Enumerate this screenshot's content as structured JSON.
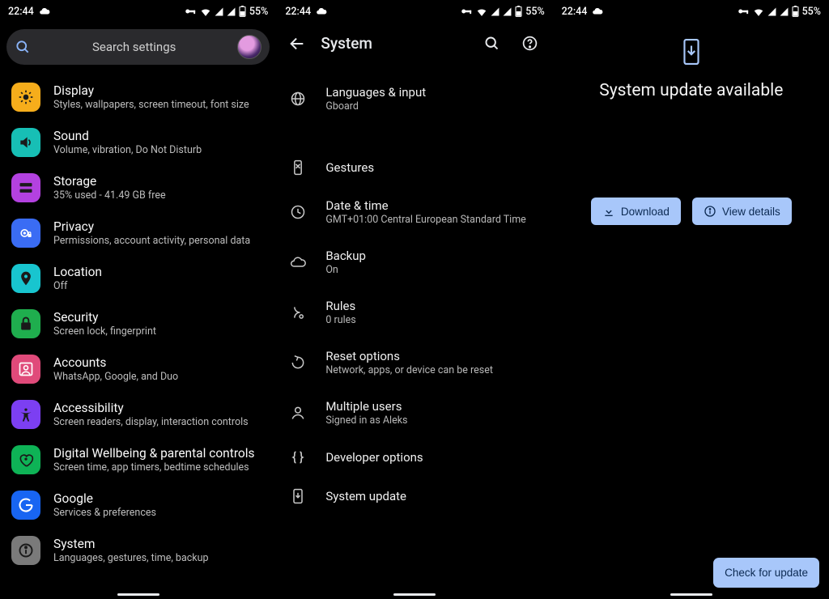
{
  "status": {
    "time": "22:44",
    "battery": "55%"
  },
  "panel1": {
    "search_placeholder": "Search settings",
    "items": [
      {
        "title": "Display",
        "sub": "Styles, wallpapers, screen timeout, font size",
        "bg": "bg-orange",
        "icon": "brightness"
      },
      {
        "title": "Sound",
        "sub": "Volume, vibration, Do Not Disturb",
        "bg": "bg-teal",
        "icon": "volume"
      },
      {
        "title": "Storage",
        "sub": "35% used - 41.49 GB free",
        "bg": "bg-purple",
        "icon": "storage"
      },
      {
        "title": "Privacy",
        "sub": "Permissions, account activity, personal data",
        "bg": "bg-blue",
        "icon": "privacy"
      },
      {
        "title": "Location",
        "sub": "Off",
        "bg": "bg-cyan",
        "icon": "location"
      },
      {
        "title": "Security",
        "sub": "Screen lock, fingerprint",
        "bg": "bg-green",
        "icon": "lock"
      },
      {
        "title": "Accounts",
        "sub": "WhatsApp, Google, and Duo",
        "bg": "bg-pink",
        "icon": "account"
      },
      {
        "title": "Accessibility",
        "sub": "Screen readers, display, interaction controls",
        "bg": "bg-violet",
        "icon": "a11y"
      },
      {
        "title": "Digital Wellbeing & parental controls",
        "sub": "Screen time, app timers, bedtime schedules",
        "bg": "bg-heart",
        "icon": "heart"
      },
      {
        "title": "Google",
        "sub": "Services & preferences",
        "bg": "bg-g",
        "icon": "google"
      },
      {
        "title": "System",
        "sub": "Languages, gestures, time, backup",
        "bg": "bg-gray",
        "icon": "info"
      }
    ]
  },
  "panel2": {
    "title": "System",
    "items": [
      {
        "title": "Languages & input",
        "sub": "Gboard",
        "icon": "globe",
        "tall": true
      },
      {
        "title": "Gestures",
        "sub": "",
        "icon": "gesture"
      },
      {
        "title": "Date & time",
        "sub": "GMT+01:00 Central European Standard Time",
        "icon": "clock"
      },
      {
        "title": "Backup",
        "sub": "On",
        "icon": "cloud"
      },
      {
        "title": "Rules",
        "sub": "0 rules",
        "icon": "rules"
      },
      {
        "title": "Reset options",
        "sub": "Network, apps, or device can be reset",
        "icon": "reset"
      },
      {
        "title": "Multiple users",
        "sub": "Signed in as Aleks",
        "icon": "person"
      },
      {
        "title": "Developer options",
        "sub": "",
        "icon": "braces"
      },
      {
        "title": "System update",
        "sub": "",
        "icon": "update-phone"
      }
    ]
  },
  "panel3": {
    "title": "System update available",
    "download_label": "Download",
    "details_label": "View details",
    "check_label": "Check for update"
  }
}
